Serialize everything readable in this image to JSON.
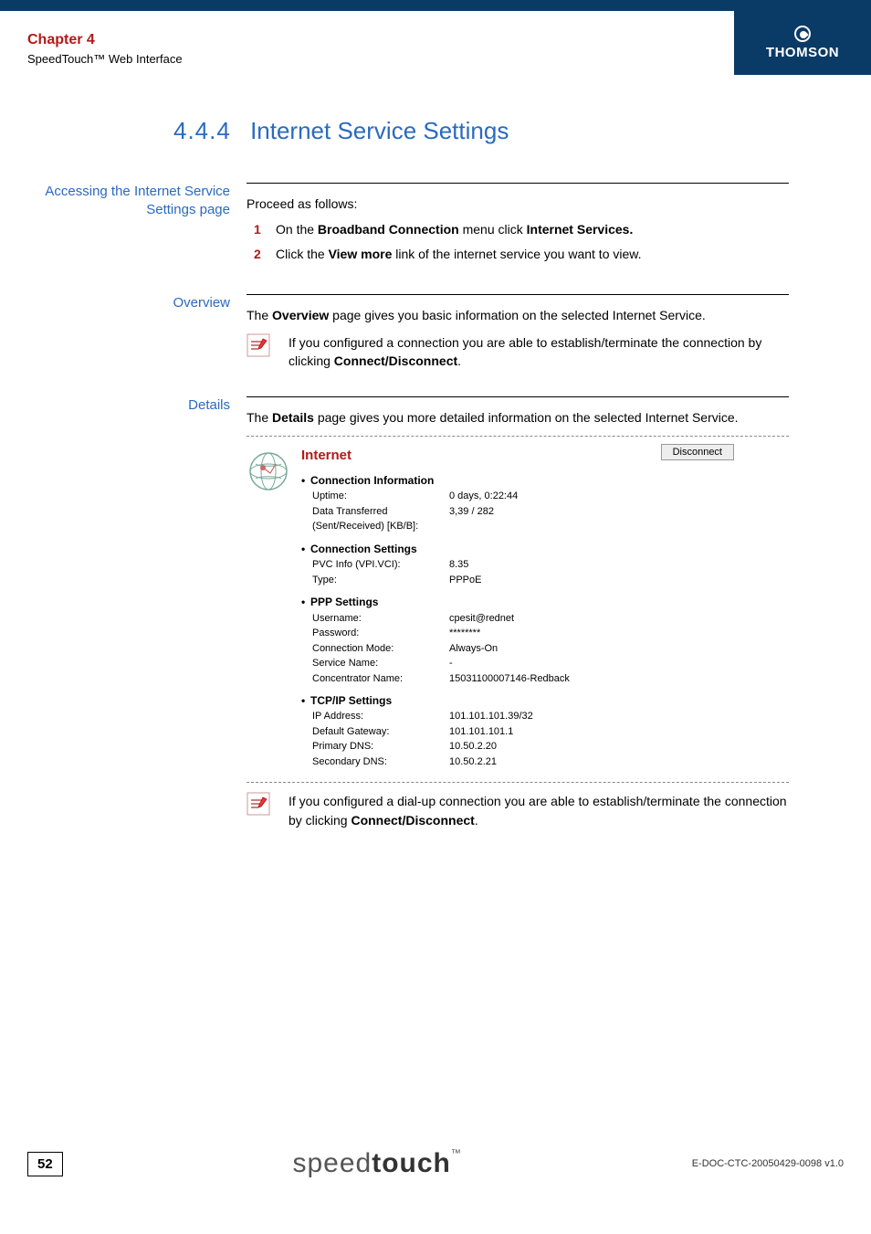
{
  "header": {
    "chapter_title": "Chapter 4",
    "chapter_sub": "SpeedTouch™ Web Interface",
    "brand": "THOMSON"
  },
  "page_title": {
    "number": "4.4.4",
    "text": "Internet Service Settings"
  },
  "sections": {
    "accessing": {
      "label": "Accessing the Internet Service Settings page",
      "intro": "Proceed as follows:",
      "steps": [
        {
          "num": "1",
          "pre": "On the ",
          "b1": "Broadband Connection",
          "mid": " menu click ",
          "b2": "Internet Services."
        },
        {
          "num": "2",
          "pre": "Click the ",
          "b1": "View more",
          "mid": " link of the internet service you want to view."
        }
      ]
    },
    "overview": {
      "label": "Overview",
      "text_pre": "The ",
      "text_b": "Overview",
      "text_post": " page gives you basic information on the selected Internet Service.",
      "note_pre": "If you configured a connection you are able to establish/terminate the connection by clicking ",
      "note_b": "Connect/Disconnect",
      "note_post": "."
    },
    "details": {
      "label": "Details",
      "text_pre": "The ",
      "text_b": "Details",
      "text_post": " page gives you more detailed information on the selected Internet Service.",
      "panel": {
        "title": "Internet",
        "button": "Disconnect",
        "groups": [
          {
            "heading": "Connection Information",
            "rows": [
              {
                "k": "Uptime:",
                "v": "0 days, 0:22:44"
              },
              {
                "k": "Data Transferred (Sent/Received) [KB/B]:",
                "v": "3,39 / 282"
              }
            ]
          },
          {
            "heading": "Connection Settings",
            "rows": [
              {
                "k": "PVC Info (VPI.VCI):",
                "v": "8.35"
              },
              {
                "k": "Type:",
                "v": "PPPoE"
              }
            ]
          },
          {
            "heading": "PPP Settings",
            "rows": [
              {
                "k": "Username:",
                "v": "cpesit@rednet"
              },
              {
                "k": "Password:",
                "v": "********"
              },
              {
                "k": "Connection Mode:",
                "v": "Always-On"
              },
              {
                "k": "Service Name:",
                "v": "-"
              },
              {
                "k": "Concentrator Name:",
                "v": "15031100007146-Redback"
              }
            ]
          },
          {
            "heading": "TCP/IP Settings",
            "rows": [
              {
                "k": "IP Address:",
                "v": "101.101.101.39/32"
              },
              {
                "k": "Default Gateway:",
                "v": "101.101.101.1"
              },
              {
                "k": "Primary DNS:",
                "v": "10.50.2.20"
              },
              {
                "k": "Secondary DNS:",
                "v": "10.50.2.21"
              }
            ]
          }
        ]
      },
      "note_pre": "If you configured a dial-up connection you are able to establish/terminate the connection by clicking ",
      "note_b": "Connect/Disconnect",
      "note_post": "."
    }
  },
  "footer": {
    "page_num": "52",
    "logo_light": "speed",
    "logo_bold": "touch",
    "logo_tm": "™",
    "doc_id": "E-DOC-CTC-20050429-0098 v1.0"
  }
}
